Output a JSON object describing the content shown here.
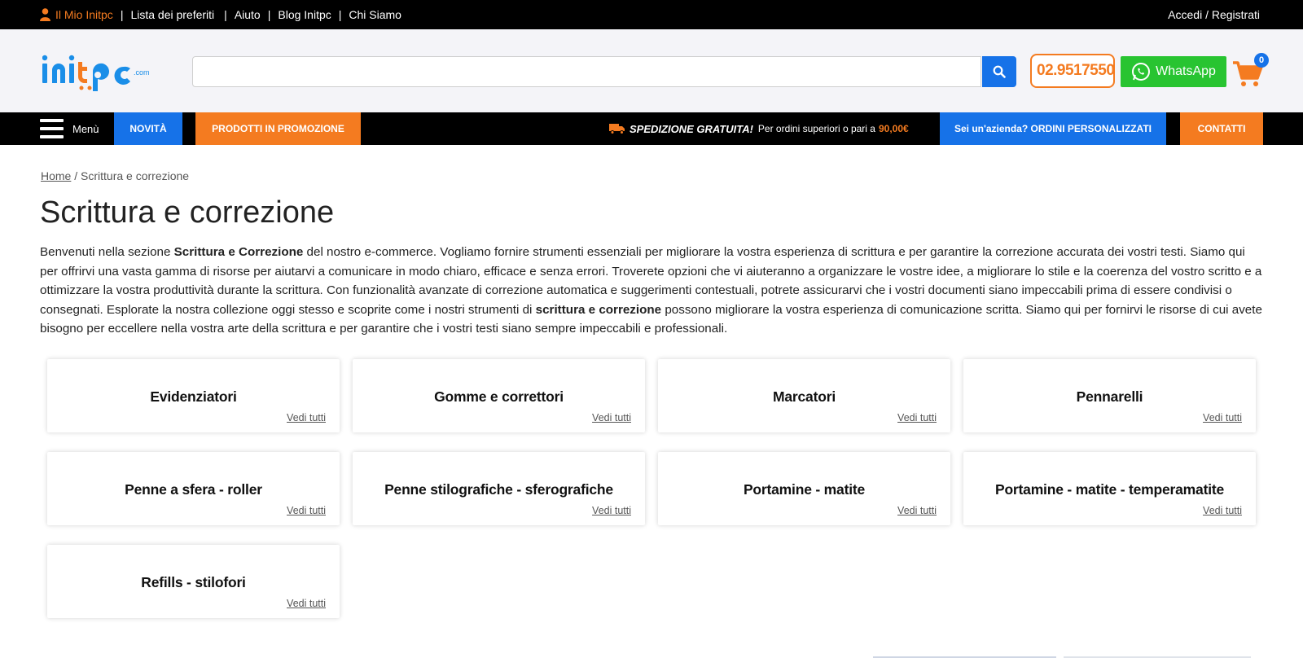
{
  "topbar": {
    "user_link": "Il Mio Initpc",
    "links": [
      "Lista dei preferiti",
      "Aiuto",
      "Blog Initpc",
      "Chi Siamo"
    ],
    "account": "Accedi / Registrati"
  },
  "header": {
    "search_value": "",
    "phone": "02.9517550",
    "whatsapp": "WhatsApp",
    "cart_count": "0",
    "brand_color": "#f47b20",
    "accent_color": "#1672e8"
  },
  "nav": {
    "menu": "Menù",
    "novita": "NOVITÀ",
    "promo": "PRODOTTI IN PROMOZIONE",
    "shipping_title": "SPEDIZIONE GRATUITA!",
    "shipping_text": "Per ordini superiori o pari a",
    "shipping_price": "90,00€",
    "azienda": "Sei un'azienda? ORDINI PERSONALIZZATI",
    "contatti": "CONTATTI"
  },
  "breadcrumb": {
    "home": "Home",
    "separator": " / ",
    "current": "Scrittura e correzione"
  },
  "page": {
    "title": "Scrittura e correzione",
    "intro": {
      "p1": "Benvenuti nella sezione ",
      "b1": "Scrittura e Correzione",
      "p2": " del nostro e-commerce. Vogliamo fornire strumenti essenziali per migliorare la vostra esperienza di scrittura e per garantire la correzione accurata dei vostri testi. Siamo qui per offrirvi una vasta gamma di risorse per aiutarvi a comunicare in modo chiaro, efficace e senza errori. Troverete opzioni che vi aiuteranno a organizzare le vostre idee, a migliorare lo stile e la coerenza del vostro scritto e a ottimizzare la vostra produttività durante la scrittura. Con funzionalità avanzate di correzione automatica e suggerimenti contestuali, potrete assicurarvi che i vostri documenti siano impeccabili prima di essere condivisi o consegnati. Esplorate la nostra collezione oggi stesso e scoprite come i nostri strumenti di ",
      "b2": "scrittura e correzione",
      "p3": " possono migliorare la vostra esperienza di comunicazione scritta. Siamo qui per fornirvi le risorse di cui avete bisogno per eccellere nella vostra arte della scrittura e per garantire che i vostri testi siano sempre impeccabili e professionali."
    }
  },
  "categories": [
    {
      "name": "Evidenziatori",
      "link": "Vedi tutti"
    },
    {
      "name": "Gomme e correttori",
      "link": "Vedi tutti"
    },
    {
      "name": "Marcatori",
      "link": "Vedi tutti"
    },
    {
      "name": "Pennarelli",
      "link": "Vedi tutti"
    },
    {
      "name": "Penne a sfera - roller",
      "link": "Vedi tutti"
    },
    {
      "name": "Penne stilografiche - sferografiche",
      "link": "Vedi tutti"
    },
    {
      "name": "Portamine - matite",
      "link": "Vedi tutti"
    },
    {
      "name": "Portamine - matite - temperamatite",
      "link": "Vedi tutti"
    },
    {
      "name": "Refills - stilofori",
      "link": "Vedi tutti"
    }
  ]
}
